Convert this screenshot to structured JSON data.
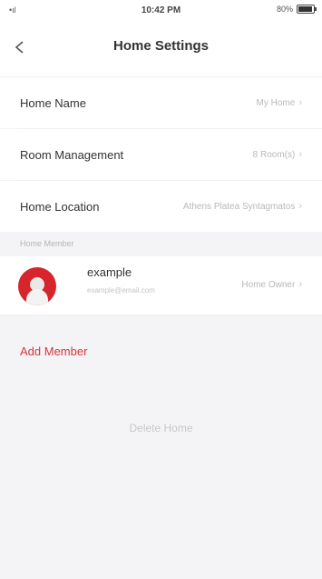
{
  "status_bar": {
    "signal": "•ıl",
    "time": "10:42 PM",
    "battery": "80%"
  },
  "nav": {
    "back_icon": "chevron-left-icon",
    "title": "Home Settings"
  },
  "settings": {
    "home_name": {
      "label": "Home Name",
      "value": "My Home"
    },
    "room_management": {
      "label": "Room Management",
      "value": "8 Room(s)"
    },
    "home_location": {
      "label": "Home Location",
      "value": "Athens Platea Syntagmatos"
    }
  },
  "members": {
    "section_title": "Home Member",
    "items": [
      {
        "name": "example",
        "email": "example@email.com",
        "role": "Home Owner"
      }
    ],
    "add_label": "Add Member"
  },
  "actions": {
    "delete_home": "Delete Home"
  },
  "colors": {
    "accent_red": "#d9363c",
    "avatar_red": "#d6252b",
    "background": "#f4f4f6"
  }
}
